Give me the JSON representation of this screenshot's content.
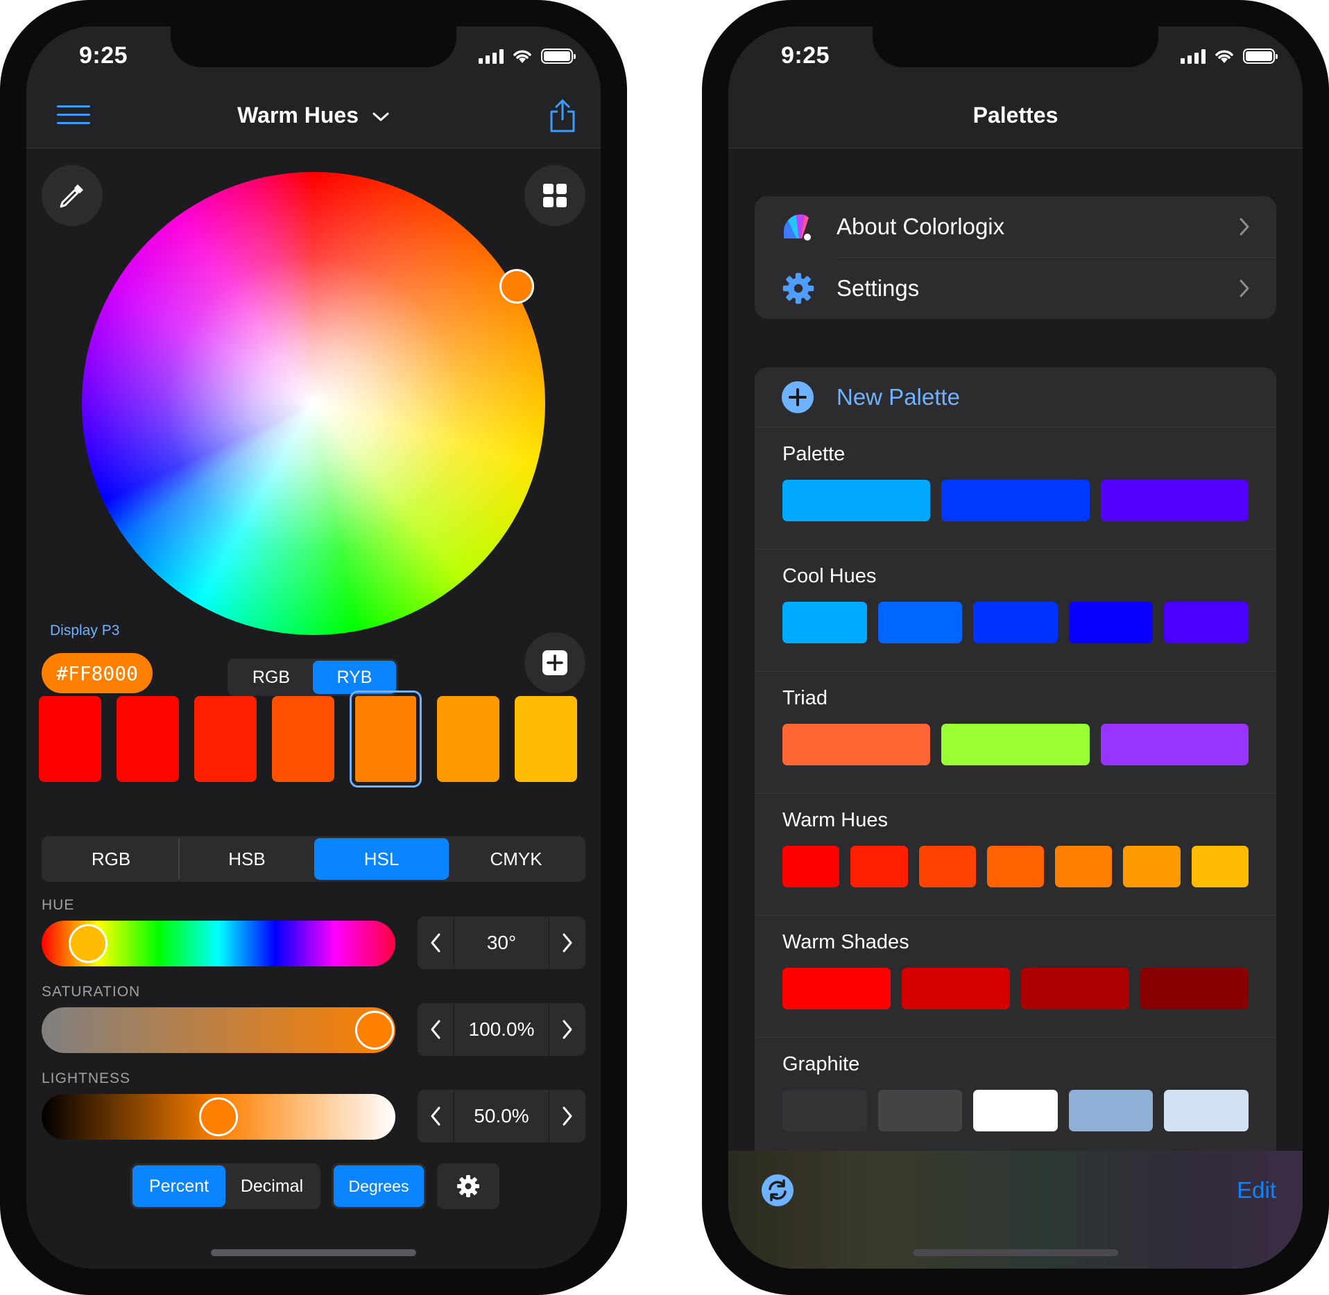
{
  "status_bar": {
    "time": "9:25"
  },
  "editor": {
    "title": "Warm Hues",
    "color_space_label": "Display P3",
    "hex_value": "#FF8000",
    "current_color": "#FF8000",
    "wheel_modes": [
      "RGB",
      "RYB"
    ],
    "wheel_mode_active": "RYB",
    "swatches": [
      "#FF0000",
      "#FF0500",
      "#FF2000",
      "#FF5000",
      "#FF8000",
      "#FF9B00",
      "#FFBB00"
    ],
    "selected_swatch_index": 4,
    "model_tabs": [
      "RGB",
      "HSB",
      "HSL",
      "CMYK"
    ],
    "model_active": "HSL",
    "sliders": {
      "hue": {
        "label": "HUE",
        "value": "30°",
        "level": 0.083
      },
      "saturation": {
        "label": "SATURATION",
        "value": "100.0%",
        "level": 1.0
      },
      "lightness": {
        "label": "LIGHTNESS",
        "value": "50.0%",
        "level": 0.5
      }
    },
    "format_options": [
      "Percent",
      "Decimal"
    ],
    "format_active": "Percent",
    "angle_option": "Degrees"
  },
  "palettes_screen": {
    "title": "Palettes",
    "menu": [
      {
        "label": "About Colorlogix",
        "icon": "colorlogix-app-icon"
      },
      {
        "label": "Settings",
        "icon": "gear-icon"
      }
    ],
    "new_palette_label": "New Palette",
    "palettes": [
      {
        "name": "Palette",
        "colors": [
          "#00A8FF",
          "#0038FF",
          "#5500FF"
        ]
      },
      {
        "name": "Cool Hues",
        "colors": [
          "#00AAFF",
          "#0066FF",
          "#0033FF",
          "#0A00FF",
          "#4A00FF"
        ]
      },
      {
        "name": "Triad",
        "colors": [
          "#FF6633",
          "#99FF33",
          "#9933FF"
        ]
      },
      {
        "name": "Warm Hues",
        "colors": [
          "#FF0000",
          "#FF2000",
          "#FF4200",
          "#FF6200",
          "#FF8000",
          "#FF9B00",
          "#FFBB00"
        ]
      },
      {
        "name": "Warm Shades",
        "colors": [
          "#FF0000",
          "#D40000",
          "#AA0000",
          "#880000"
        ]
      },
      {
        "name": "Graphite",
        "colors": [
          "#333333",
          "#444444",
          "#FFFFFF",
          "#8EAFD6",
          "#D3E2F2"
        ]
      }
    ],
    "edit_label": "Edit"
  },
  "colors": {
    "accent": "#0A84FF",
    "background": "#1C1C1E",
    "panel": "#2C2C2E"
  }
}
